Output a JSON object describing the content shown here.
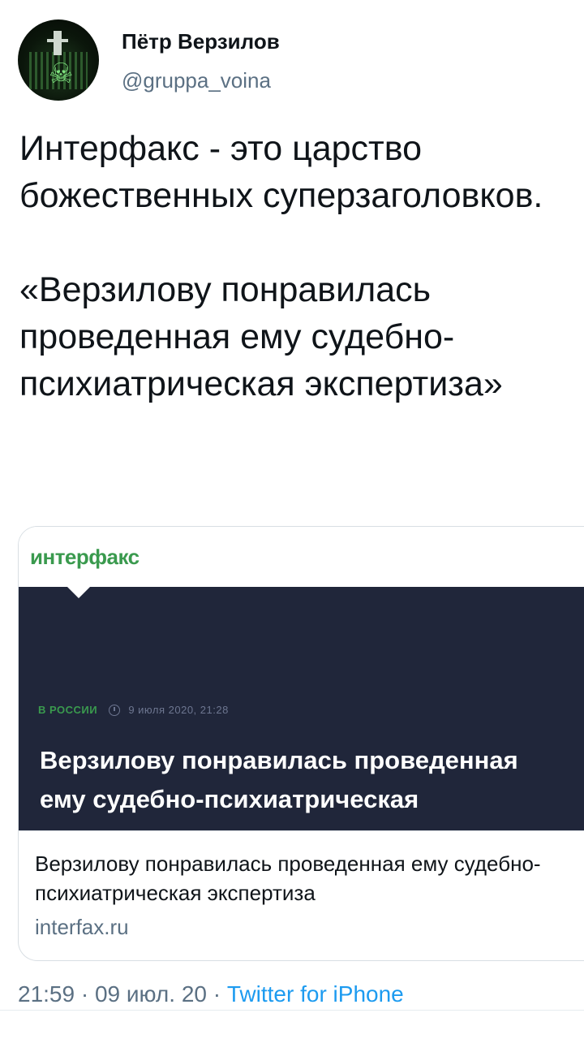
{
  "author": {
    "name": "Пётр Верзилов",
    "handle": "@gruppa_voina"
  },
  "tweet": {
    "paragraph1": "Интерфакс - это царство божественных суперзаголовков.",
    "paragraph2": "«Верзилову понравилась проведенная ему судебно-психиатрическая экспертиза»"
  },
  "card": {
    "logo": "интерфакс",
    "rubric": "В РОССИИ",
    "date": "9 июля 2020, 21:28",
    "image_headline": "Верзилову понравилась проведенная ему судебно-психиатрическая экспертиза",
    "title": "Верзилову понравилась проведенная ему судебно-психиатрическая экспертиза",
    "domain": "interfax.ru"
  },
  "footer": {
    "time": "21:59",
    "separator": " · ",
    "date": "09 июл. 20",
    "source": "Twitter for iPhone"
  },
  "colors": {
    "brand_green": "#3a9a4e",
    "card_dark": "#20263a",
    "link_blue": "#1d9bf0",
    "secondary_text": "#5b7083"
  },
  "icons": {
    "clock": "clock-icon"
  }
}
